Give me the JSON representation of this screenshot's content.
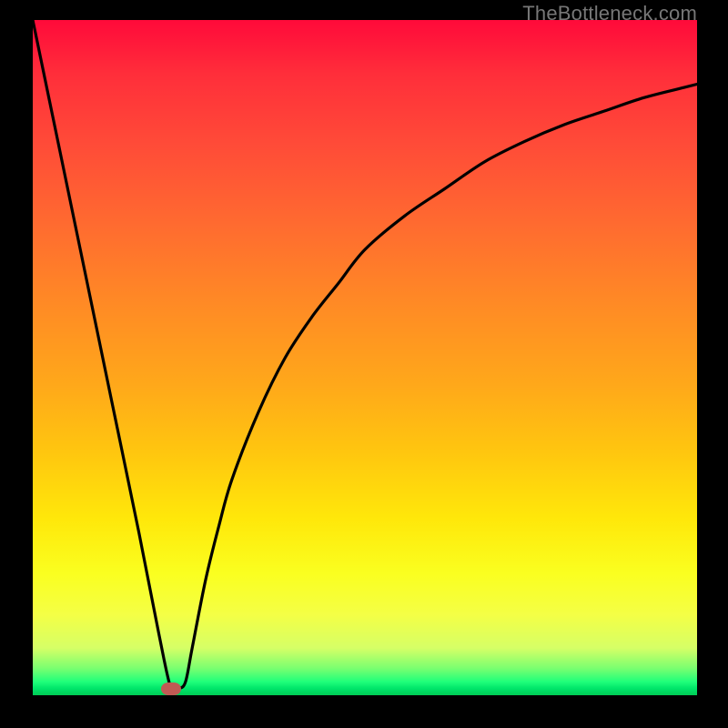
{
  "watermark": "TheBottleneck.com",
  "colors": {
    "background": "#000000",
    "gradient_top": "#ff0a3a",
    "gradient_bottom": "#00cc55",
    "curve": "#000000",
    "marker": "#c05a54",
    "watermark_text": "#777777"
  },
  "chart_data": {
    "type": "line",
    "title": "",
    "xlabel": "",
    "ylabel": "",
    "xlim": [
      0,
      100
    ],
    "ylim": [
      0,
      100
    ],
    "grid": false,
    "series": [
      {
        "name": "bottleneck-curve",
        "x": [
          0,
          4,
          8,
          12,
          16,
          19,
          20.8,
          22,
          23,
          24,
          26,
          28,
          30,
          34,
          38,
          42,
          46,
          50,
          56,
          62,
          68,
          74,
          80,
          86,
          92,
          98,
          100
        ],
        "values": [
          100,
          81,
          62,
          43,
          24,
          9,
          1,
          1,
          2,
          7,
          17,
          25,
          32,
          42,
          50,
          56,
          61,
          66,
          71,
          75,
          79,
          82,
          84.5,
          86.5,
          88.5,
          90,
          90.5
        ]
      }
    ],
    "marker": {
      "x": 20.8,
      "y": 1,
      "shape": "rounded-rect",
      "color": "#c05a54"
    },
    "background_gradient": {
      "orientation": "vertical",
      "stops": [
        {
          "pos": 0.0,
          "color": "#ff0a3a"
        },
        {
          "pos": 0.3,
          "color": "#ff6a30"
        },
        {
          "pos": 0.6,
          "color": "#ffc60f"
        },
        {
          "pos": 0.82,
          "color": "#faff20"
        },
        {
          "pos": 0.96,
          "color": "#7aff70"
        },
        {
          "pos": 1.0,
          "color": "#00cc55"
        }
      ]
    }
  }
}
